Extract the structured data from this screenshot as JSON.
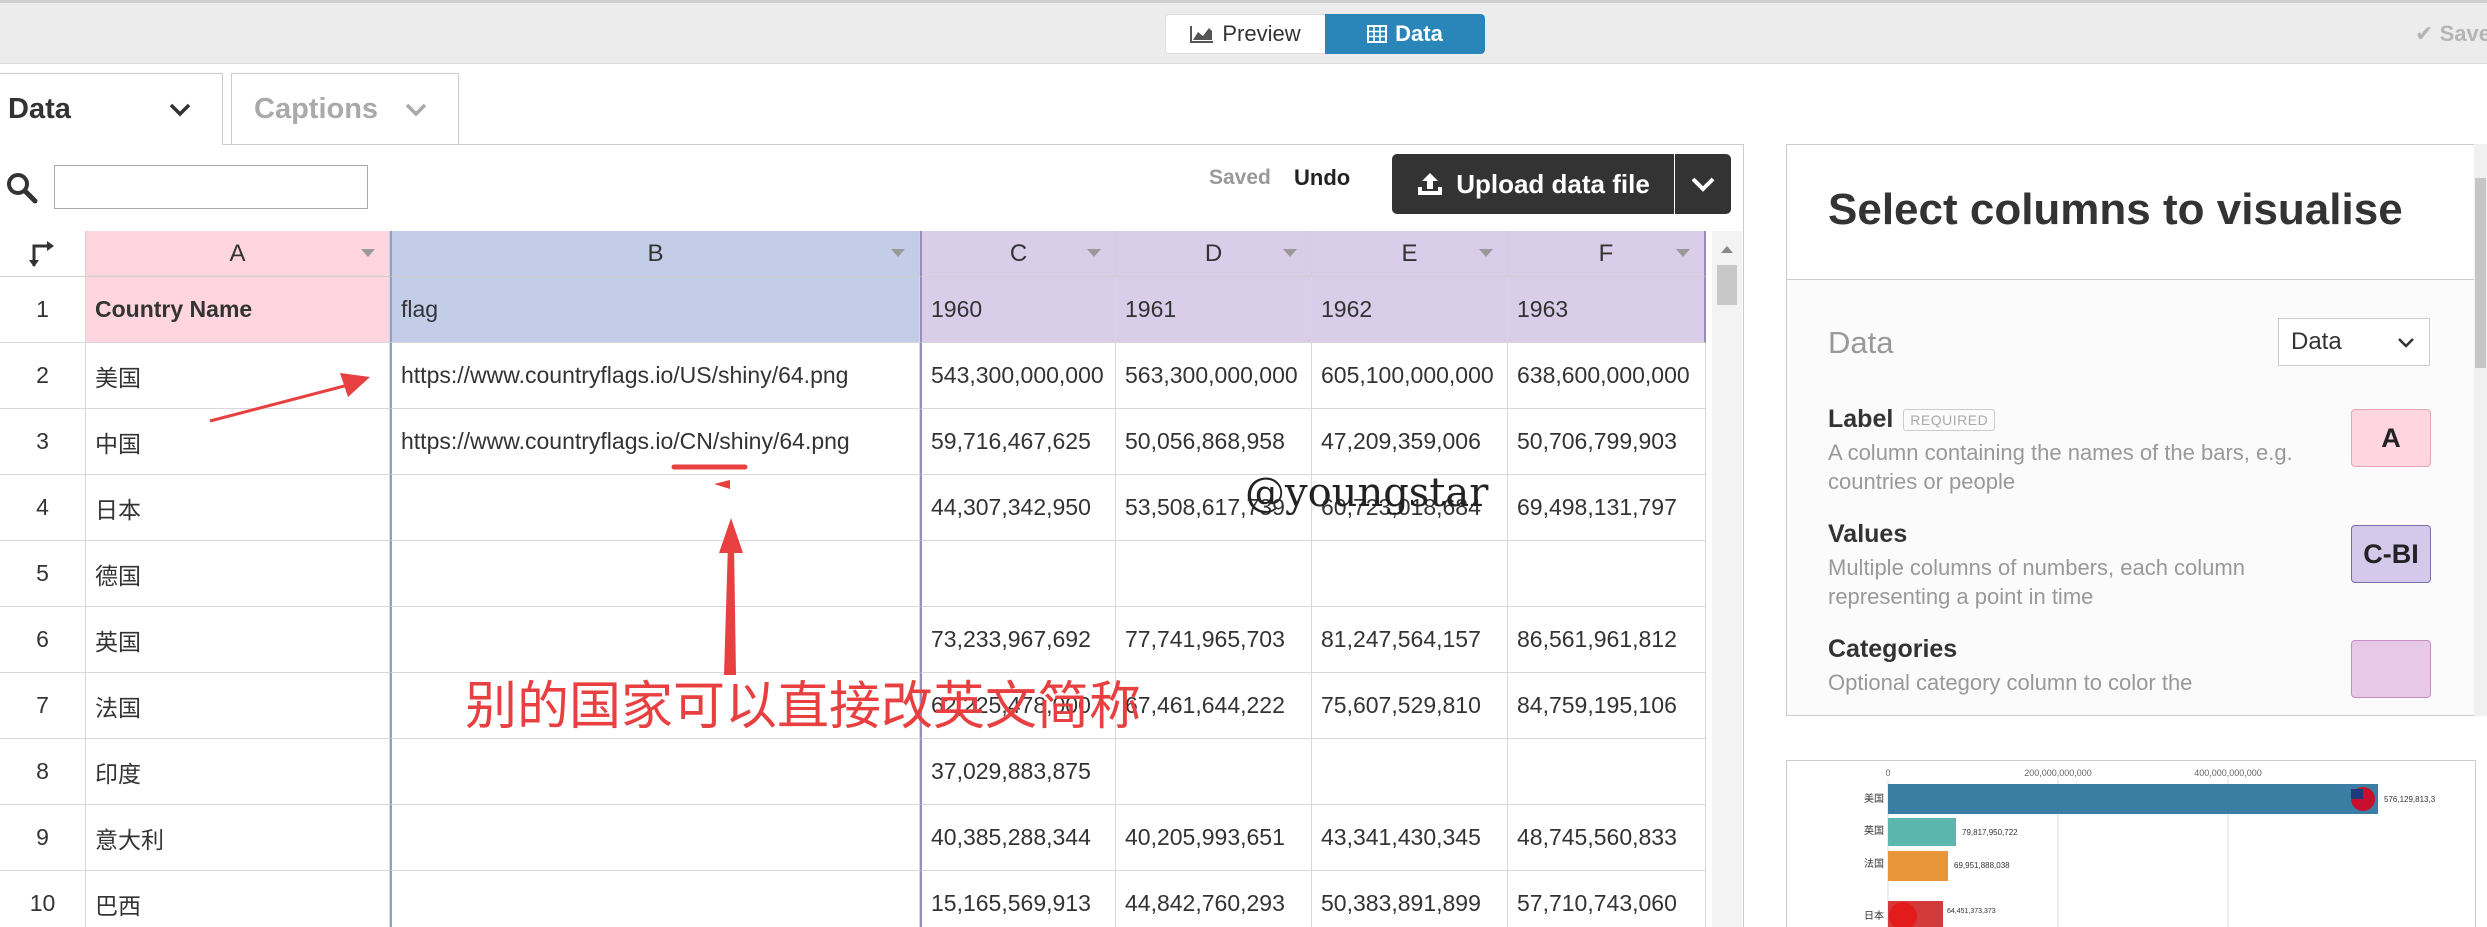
{
  "topbar": {
    "preview_label": "Preview",
    "data_label": "Data",
    "save_label": "Save"
  },
  "tabs": [
    {
      "label": "Data"
    },
    {
      "label": "Captions"
    }
  ],
  "toolbar": {
    "search_placeholder": "",
    "saved_label": "Saved",
    "undo_label": "Undo",
    "upload_label": "Upload data file"
  },
  "grid": {
    "columns": [
      "A",
      "B",
      "C",
      "D",
      "E",
      "F"
    ],
    "headers": [
      "Country Name",
      "flag",
      "1960",
      "1961",
      "1962",
      "1963"
    ],
    "rows": [
      {
        "num": "2",
        "cells": [
          "美国",
          "https://www.countryflags.io/US/shiny/64.png",
          "543,300,000,000",
          "563,300,000,000",
          "605,100,000,000",
          "638,600,000,000"
        ]
      },
      {
        "num": "3",
        "cells": [
          "中国",
          "https://www.countryflags.io/CN/shiny/64.png",
          "59,716,467,625",
          "50,056,868,958",
          "47,209,359,006",
          "50,706,799,903"
        ]
      },
      {
        "num": "4",
        "cells": [
          "日本",
          "",
          "44,307,342,950",
          "53,508,617,739",
          "60,723,018,684",
          "69,498,131,797"
        ]
      },
      {
        "num": "5",
        "cells": [
          "德国",
          "",
          "",
          "",
          "",
          ""
        ]
      },
      {
        "num": "6",
        "cells": [
          "英国",
          "",
          "73,233,967,692",
          "77,741,965,703",
          "81,247,564,157",
          "86,561,961,812"
        ]
      },
      {
        "num": "7",
        "cells": [
          "法国",
          "",
          "62,225,478,000",
          "67,461,644,222",
          "75,607,529,810",
          "84,759,195,106"
        ]
      },
      {
        "num": "8",
        "cells": [
          "印度",
          "",
          "37,029,883,875",
          "",
          "",
          ""
        ]
      },
      {
        "num": "9",
        "cells": [
          "意大利",
          "",
          "40,385,288,344",
          "40,205,993,651",
          "43,341,430,345",
          "48,745,560,833"
        ]
      },
      {
        "num": "10",
        "cells": [
          "巴西",
          "",
          "15,165,569,913",
          "44,842,760,293",
          "50,383,891,899",
          "57,710,743,060"
        ]
      }
    ]
  },
  "right_panel": {
    "title": "Select columns to visualise",
    "data_label": "Data",
    "data_select_value": "Data",
    "dimensions": [
      {
        "name": "Label",
        "badge": "REQUIRED",
        "desc": "A column containing the names of the bars, e.g. countries or people",
        "chip": "A"
      },
      {
        "name": "Values",
        "badge": "",
        "desc": "Multiple columns of numbers, each column representing a point in time",
        "chip": "C-BI"
      },
      {
        "name": "Categories",
        "badge": "",
        "desc": "Optional category column to color the",
        "chip": ""
      }
    ]
  },
  "preview_chart": {
    "ticks": [
      "0",
      "200,000,000,000",
      "400,000,000,000"
    ],
    "bars": [
      {
        "label": "美国",
        "value_label": "576,129,813,3"
      },
      {
        "label": "英国",
        "value_label": "79,817,950,722"
      },
      {
        "label": "法国",
        "value_label": "69,951,888,038"
      },
      {
        "label": "日本",
        "value_label": "64,451,373,373"
      }
    ]
  },
  "annotations": {
    "note": "别的国家可以直接改英文简称",
    "watermark": "@youngstar"
  },
  "colors": {
    "accent": "#2a86b9",
    "label_column": "#ffd6df",
    "flag_column": "#c3cde8",
    "value_columns": "#d9cdea",
    "annotation": "#e84040"
  }
}
